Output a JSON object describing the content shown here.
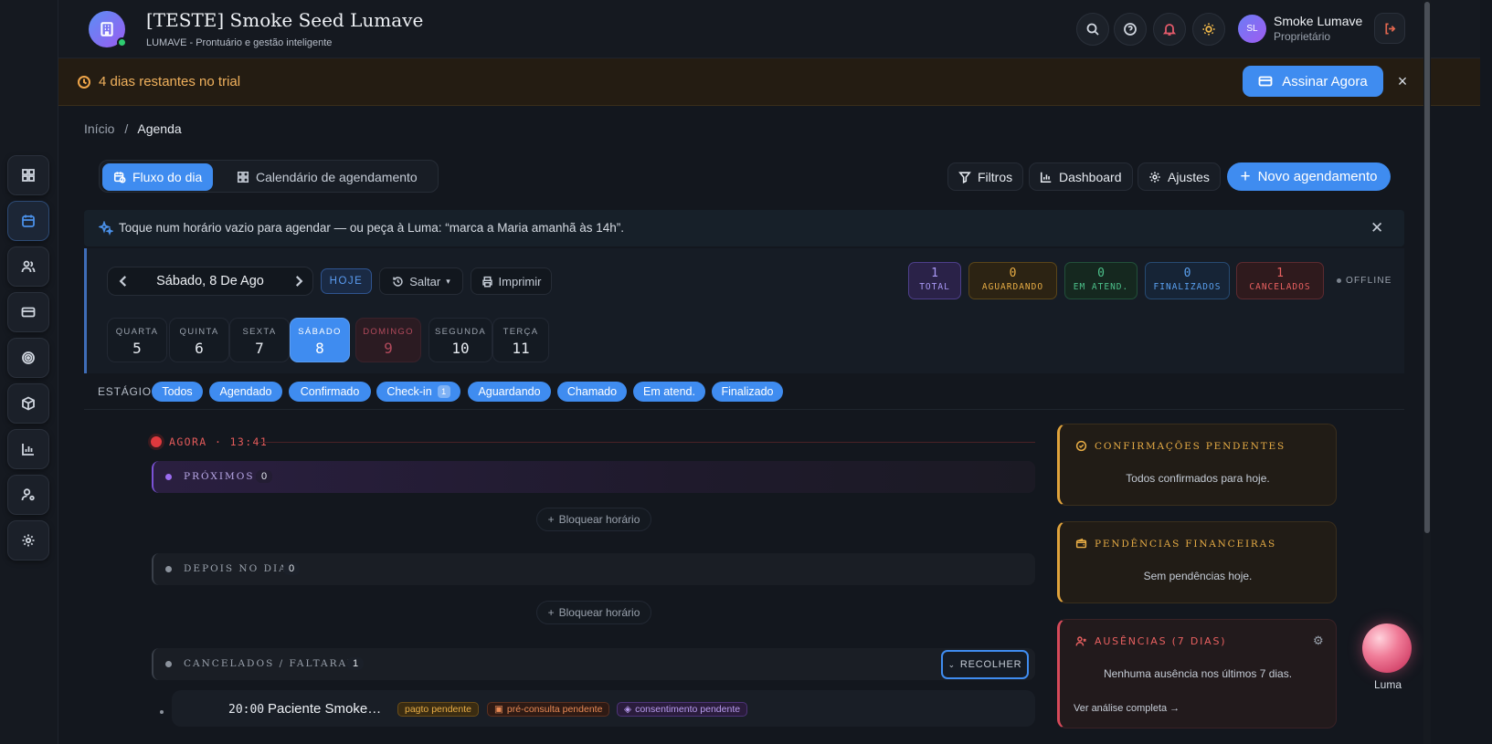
{
  "header": {
    "title": "[TESTE] Smoke Seed Lumave",
    "subtitle": "LUMAVE - Prontuário e gestão inteligente",
    "user_initials": "SL",
    "user_name": "Smoke Lumave",
    "user_role": "Proprietário"
  },
  "trial": {
    "text": "4 dias restantes no trial",
    "button": "Assinar Agora"
  },
  "breadcrumb": {
    "home": "Início",
    "sep": "/",
    "current": "Agenda"
  },
  "tabs": [
    {
      "label": "Fluxo do dia",
      "active": true
    },
    {
      "label": "Calendário de agendamento",
      "active": false
    }
  ],
  "toolbar": {
    "filters": "Filtros",
    "dashboard": "Dashboard",
    "settings": "Ajustes",
    "new_appointment": "Novo agendamento"
  },
  "hint": "Toque num horário vazio para agendar — ou peça à Luma: “marca a Maria amanhã às 14h”.",
  "date_nav": {
    "date": "Sábado, 8 De Ago",
    "today": "HOJE",
    "jump": "Saltar",
    "print": "Imprimir"
  },
  "stats": [
    {
      "value": "1",
      "label": "TOTAL",
      "color": "#8c7cf0"
    },
    {
      "value": "0",
      "label": "AGUARDANDO",
      "color": "#e0a33c"
    },
    {
      "value": "0",
      "label": "EM ATEND.",
      "color": "#4cc08a"
    },
    {
      "value": "0",
      "label": "FINALIZADOS",
      "color": "#5aa0ef"
    },
    {
      "value": "1",
      "label": "CANCELADOS",
      "color": "#e05a5a"
    }
  ],
  "status": "OFFLINE",
  "days": [
    {
      "name": "QUARTA",
      "num": "5"
    },
    {
      "name": "QUINTA",
      "num": "6"
    },
    {
      "name": "SEXTA",
      "num": "7"
    },
    {
      "name": "SÁBADO",
      "num": "8"
    },
    {
      "name": "DOMINGO",
      "num": "9"
    },
    {
      "name": "SEGUNDA",
      "num": "10"
    },
    {
      "name": "TERÇA",
      "num": "11"
    }
  ],
  "stage": {
    "label": "ESTÁGIO",
    "pills": [
      {
        "label": "Todos"
      },
      {
        "label": "Agendado"
      },
      {
        "label": "Confirmado"
      },
      {
        "label": "Check-in",
        "count": "1"
      },
      {
        "label": "Aguardando"
      },
      {
        "label": "Chamado"
      },
      {
        "label": "Em atend."
      },
      {
        "label": "Finalizado"
      }
    ]
  },
  "timeline": {
    "now": "AGORA · 13:41",
    "next_label": "PRÓXIMOS",
    "next_count": "0",
    "block": "Bloquear horário",
    "later_label": "DEPOIS NO DIA",
    "later_count": "0",
    "cancel_label": "CANCELADOS / FALTARAM",
    "cancel_count": "1",
    "collapse": "RECOLHER",
    "appointment": {
      "time": "20:00",
      "patient": "Paciente Smoke Seed",
      "tags": [
        "pagto pendente",
        "pré-consulta pendente",
        "consentimento pendente"
      ]
    }
  },
  "cards": {
    "confirm_title": "CONFIRMAÇÕES PENDENTES",
    "confirm_body": "Todos confirmados para hoje.",
    "finance_title": "PENDÊNCIAS FINANCEIRAS",
    "finance_body": "Sem pendências hoje.",
    "absence_title": "AUSÊNCIAS (7 DIAS)",
    "absence_body": "Nenhuma ausência nos últimos 7 dias.",
    "absence_link": "Ver análise completa →"
  },
  "luma": "Luma",
  "colors": {
    "accent": "#3f8cf0",
    "warning": "#f0a64a",
    "danger": "#e05a5a"
  }
}
